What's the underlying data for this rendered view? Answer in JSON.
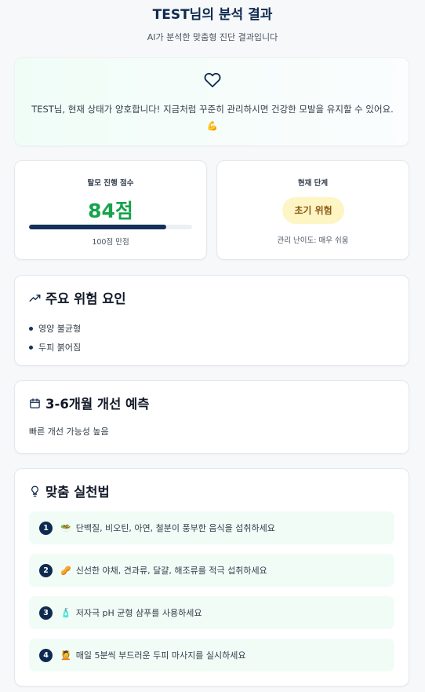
{
  "header": {
    "title": "TEST님의 분석 결과",
    "subtitle": "AI가 분석한 맞춤형 진단 결과입니다"
  },
  "hero": {
    "icon": "heart-icon",
    "message": "TEST님, 현재 상태가 양호합니다! 지금처럼 꾸준히 관리하시면 건강한 모발을 유지할 수 있어요. 💪"
  },
  "score": {
    "label": "탈모 진행 점수",
    "value_text": "84점",
    "value": 84,
    "max": 100,
    "max_text": "100점 만점",
    "color": "#16a34a",
    "bar_color": "#14305a"
  },
  "stage": {
    "label": "현재 단계",
    "badge": "초기 위험",
    "difficulty": "관리 난이도: 매우 쉬움",
    "badge_bg": "#fdf5c4",
    "badge_color": "#8a5a12"
  },
  "risk": {
    "icon": "trending-up-icon",
    "title": "주요 위험 요인",
    "items": [
      "영양 불균형",
      "두피 붉어짐"
    ]
  },
  "prediction": {
    "icon": "calendar-icon",
    "title": "3-6개월 개선 예측",
    "text": "빠른 개선 가능성 높음"
  },
  "tips": {
    "icon": "lightbulb-icon",
    "title": "맞춤 실천법",
    "items": [
      {
        "num": "1",
        "emoji": "🥗",
        "text": "단백질, 비오틴, 아연, 철분이 풍부한 음식을 섭취하세요"
      },
      {
        "num": "2",
        "emoji": "🥜",
        "text": "신선한 야채, 견과류, 달걀, 해조류를 적극 섭취하세요"
      },
      {
        "num": "3",
        "emoji": "🧴",
        "text": "저자극 pH 균형 샴푸를 사용하세요"
      },
      {
        "num": "4",
        "emoji": "💆",
        "text": "매일 5분씩 부드러운 두피 마사지를 실시하세요"
      }
    ]
  }
}
